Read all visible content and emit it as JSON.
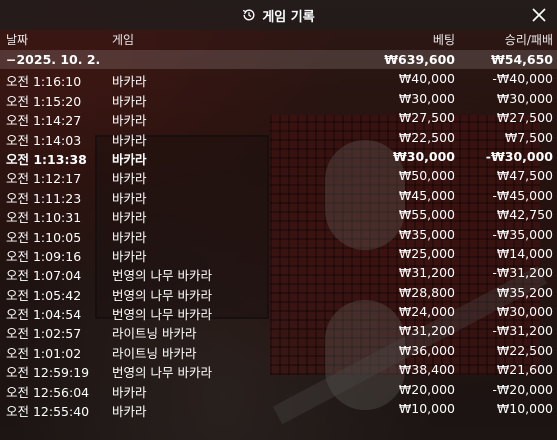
{
  "header": {
    "title": "게임 기록",
    "icon": "history-icon"
  },
  "columns": {
    "date": "날짜",
    "game": "게임",
    "bet": "베팅",
    "result": "승리/패배"
  },
  "summary": {
    "date": "−2025. 10. 2.",
    "bet": "₩639,600",
    "result": "₩54,650"
  },
  "rows": [
    {
      "time": "오전 1:16:10",
      "game": "바카라",
      "bet": "₩40,000",
      "result": "-₩40,000"
    },
    {
      "time": "오전 1:15:20",
      "game": "바카라",
      "bet": "₩30,000",
      "result": "₩30,000"
    },
    {
      "time": "오전 1:14:27",
      "game": "바카라",
      "bet": "₩27,500",
      "result": "₩27,500"
    },
    {
      "time": "오전 1:14:03",
      "game": "바카라",
      "bet": "₩22,500",
      "result": "₩7,500"
    },
    {
      "time": "오전 1:13:38",
      "game": "바카라",
      "bet": "₩30,000",
      "result": "-₩30,000"
    },
    {
      "time": "오전 1:12:17",
      "game": "바카라",
      "bet": "₩50,000",
      "result": "₩47,500"
    },
    {
      "time": "오전 1:11:23",
      "game": "바카라",
      "bet": "₩45,000",
      "result": "-₩45,000"
    },
    {
      "time": "오전 1:10:31",
      "game": "바카라",
      "bet": "₩55,000",
      "result": "₩42,750"
    },
    {
      "time": "오전 1:10:05",
      "game": "바카라",
      "bet": "₩35,000",
      "result": "-₩35,000"
    },
    {
      "time": "오전 1:09:16",
      "game": "바카라",
      "bet": "₩25,000",
      "result": "₩14,000"
    },
    {
      "time": "오전 1:07:04",
      "game": "번영의 나무 바카라",
      "bet": "₩31,200",
      "result": "-₩31,200"
    },
    {
      "time": "오전 1:05:42",
      "game": "번영의 나무 바카라",
      "bet": "₩28,800",
      "result": "₩35,200"
    },
    {
      "time": "오전 1:04:54",
      "game": "번영의 나무 바카라",
      "bet": "₩24,000",
      "result": "₩30,000"
    },
    {
      "time": "오전 1:02:57",
      "game": "라이트닝 바카라",
      "bet": "₩31,200",
      "result": "-₩31,200"
    },
    {
      "time": "오전 1:01:02",
      "game": "라이트닝 바카라",
      "bet": "₩36,000",
      "result": "₩22,500"
    },
    {
      "time": "오전 12:59:19",
      "game": "번영의 나무 바카라",
      "bet": "₩38,400",
      "result": "₩21,600"
    },
    {
      "time": "오전 12:56:04",
      "game": "바카라",
      "bet": "₩20,000",
      "result": "-₩20,000"
    },
    {
      "time": "오전 12:55:40",
      "game": "바카라",
      "bet": "₩10,000",
      "result": "₩10,000"
    }
  ]
}
